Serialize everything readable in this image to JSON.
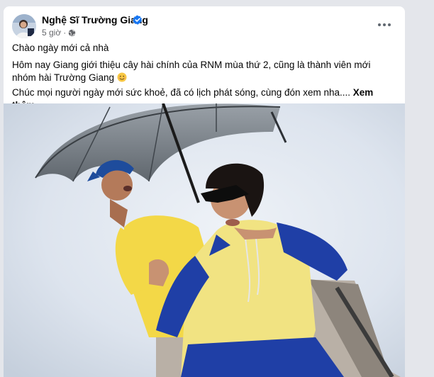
{
  "post": {
    "author": "Nghệ Sĩ Trường Giang",
    "time": "5 giờ",
    "separator": "·",
    "line1": "Chào ngày mới cả nhà",
    "line2": "Hôm nay Giang giới thiệu cây hài chính của RNM mùa thứ 2, cũng  là thành viên mới nhóm hài Trường Giang",
    "line3": "Chúc mọi người ngày mới sức khoẻ, đã có lịch phát sóng, cùng đón xem nha....",
    "see_more": "Xem thêm"
  },
  "icons": {
    "verified": "verified-badge-icon",
    "privacy": "globe-icon",
    "more": "more-options-icon",
    "emoji": "smile-emoji-icon"
  },
  "colors": {
    "verified_blue": "#1877f2",
    "background": "#e4e6eb",
    "text": "#050505",
    "muted": "#65676b"
  }
}
